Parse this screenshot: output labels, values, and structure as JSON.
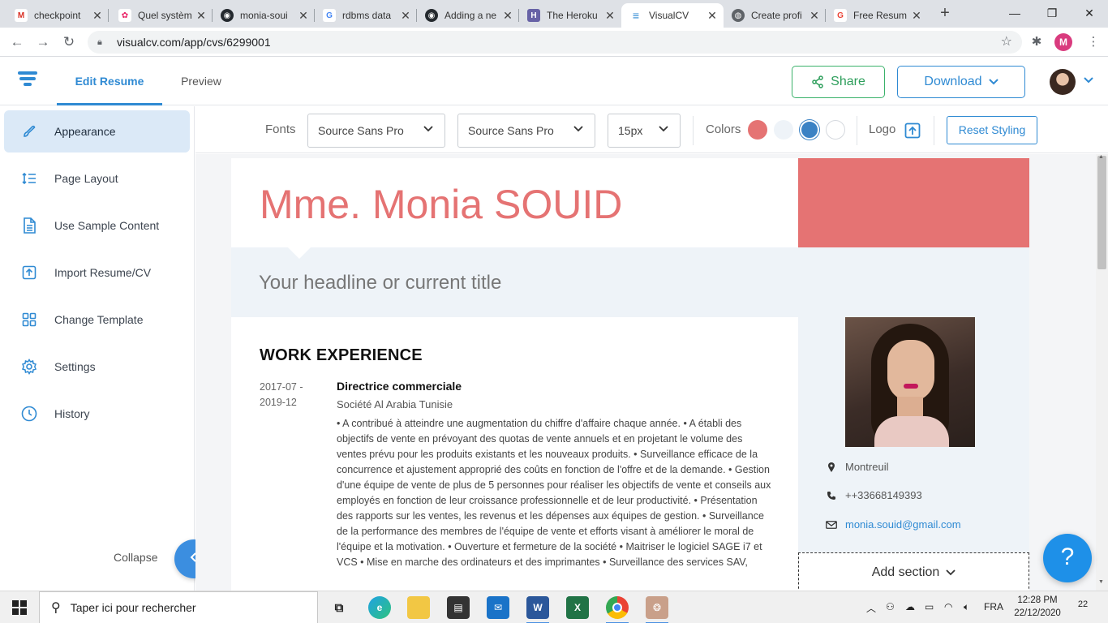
{
  "browser": {
    "tabs": [
      {
        "title": "checkpoint",
        "icon": "gmail-icon",
        "color": "#d93025",
        "glyph": "M"
      },
      {
        "title": "Quel systèm",
        "icon": "pink-site-icon",
        "color": "#e91e63",
        "glyph": "✿"
      },
      {
        "title": "monia-soui",
        "icon": "github-icon",
        "color": "#24292e",
        "glyph": "◉"
      },
      {
        "title": "rdbms data",
        "icon": "google-icon",
        "color": "#4285f4",
        "glyph": "G"
      },
      {
        "title": "Adding a ne",
        "icon": "github-icon",
        "color": "#24292e",
        "glyph": "◉"
      },
      {
        "title": "The Heroku",
        "icon": "heroku-icon",
        "color": "#6762a6",
        "glyph": "H"
      },
      {
        "title": "VisualCV",
        "icon": "visualcv-icon",
        "color": "#2f8ad3",
        "glyph": "≡"
      },
      {
        "title": "Create profi",
        "icon": "globe-icon",
        "color": "#5f6368",
        "glyph": "◍"
      },
      {
        "title": "Free Resum",
        "icon": "google-icon",
        "color": "#ea4335",
        "glyph": "G"
      }
    ],
    "url": "visualcv.com/app/cvs/6299001",
    "profile_initial": "M"
  },
  "app": {
    "tabs": {
      "edit": "Edit Resume",
      "preview": "Preview"
    },
    "share_label": "Share",
    "download_label": "Download"
  },
  "sidebar": {
    "items": [
      {
        "label": "Appearance",
        "icon": "brush-icon"
      },
      {
        "label": "Page Layout",
        "icon": "line-spacing-icon"
      },
      {
        "label": "Use Sample Content",
        "icon": "document-icon"
      },
      {
        "label": "Import Resume/CV",
        "icon": "upload-icon"
      },
      {
        "label": "Change Template",
        "icon": "grid-icon"
      },
      {
        "label": "Settings",
        "icon": "gear-icon"
      },
      {
        "label": "History",
        "icon": "clock-icon"
      }
    ],
    "collapse_label": "Collapse"
  },
  "toolbar": {
    "fonts_label": "Fonts",
    "heading_font": "Source Sans Pro",
    "body_font": "Source Sans Pro",
    "font_size": "15px",
    "colors_label": "Colors",
    "swatches": [
      "#e57373",
      "#eef3f8",
      "#3b82c4",
      "#ffffff"
    ],
    "logo_label": "Logo",
    "reset_label": "Reset Styling"
  },
  "resume": {
    "name": "Mme. Monia SOUID",
    "headline": "Your headline or current title",
    "accent_color": "#e57373",
    "section_title": "WORK EXPERIENCE",
    "job": {
      "dates": "2017-07 - 2019-12",
      "title": "Directrice commerciale",
      "company": "Société Al Arabia Tunisie",
      "description": "• A contribué à atteindre une augmentation du chiffre d'affaire chaque année. • A établi des objectifs de vente en prévoyant des quotas de vente annuels et en projetant le volume des ventes prévu pour les produits existants et les nouveaux produits. • Surveillance efficace de la concurrence et ajustement approprié des coûts en fonction de l'offre et de la demande. • Gestion d'une équipe de vente de plus de 5 personnes pour réaliser les objectifs de vente et conseils aux employés en fonction de leur croissance professionnelle et de leur productivité. • Présentation des rapports sur les ventes, les revenus et les dépenses aux équipes de gestion. • Surveillance de la performance des membres de l'équipe de vente et efforts visant à améliorer le moral de l'équipe et la motivation. • Ouverture et fermeture de la société • Maitriser le logiciel SAGE i7 et VCS • Mise en marche des ordinateurs et des imprimantes • Surveillance des services SAV,"
    },
    "contact": {
      "location": "Montreuil",
      "phone": "++33668149393",
      "email": "monia.souid@gmail.com"
    },
    "add_section_label": "Add section"
  },
  "help_label": "?",
  "taskbar": {
    "search_placeholder": "Taper ici pour rechercher",
    "language": "FRA",
    "time": "12:28 PM",
    "date": "22/12/2020",
    "notification_count": "22"
  }
}
